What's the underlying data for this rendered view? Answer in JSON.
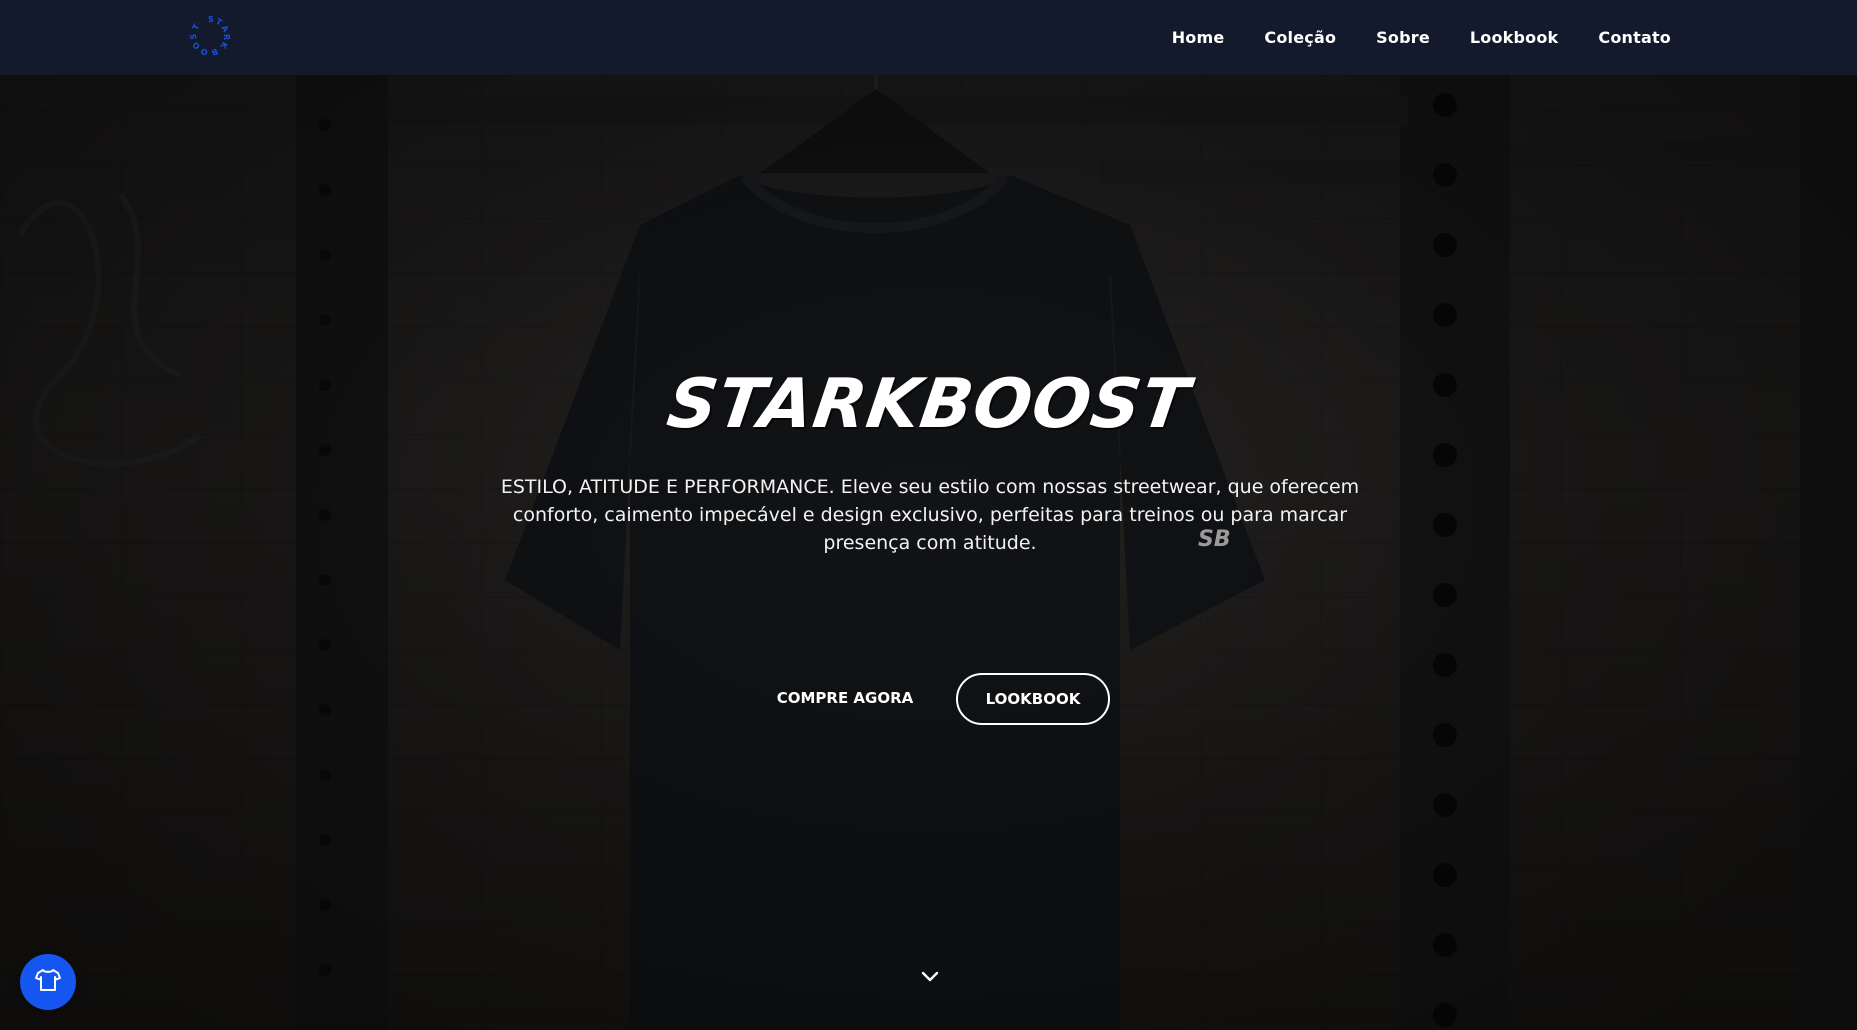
{
  "header": {
    "logo_text": "STARKBOOST",
    "nav": [
      {
        "label": "Home"
      },
      {
        "label": "Coleção"
      },
      {
        "label": "Sobre"
      },
      {
        "label": "Lookbook"
      },
      {
        "label": "Contato"
      }
    ]
  },
  "hero": {
    "title": "STARKBOOST",
    "description": "ESTILO, ATITUDE E PERFORMANCE. Eleve seu estilo com nossas streetwear, que oferecem conforto, caimento impecável e design exclusivo, perfeitas para treinos ou para marcar presença com atitude.",
    "shirt_mark": "SB",
    "buttons": {
      "buy": "COMPRE AGORA",
      "lookbook": "LOOKBOOK"
    }
  },
  "icons": {
    "logo": "starkboost-circular-logo-icon",
    "scroll": "chevron-down-icon",
    "fab": "t-shirt-icon"
  },
  "colors": {
    "header_bg": "#131a2b",
    "accent": "#1656f0",
    "text": "#ffffff"
  }
}
